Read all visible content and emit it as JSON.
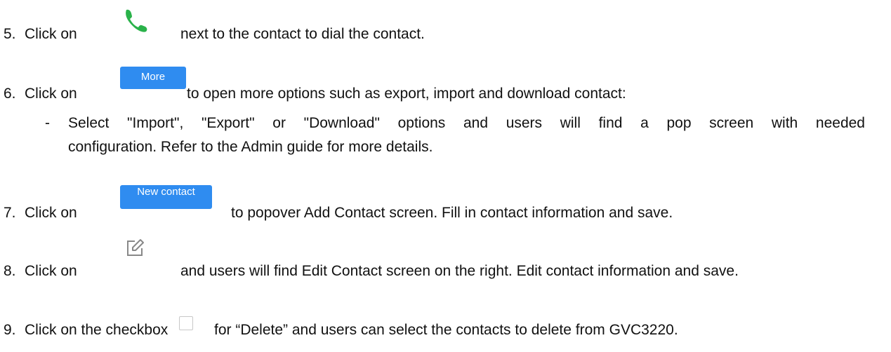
{
  "items": [
    {
      "num": "5.",
      "pre": "Click on",
      "post": "next to the contact to dial the contact."
    },
    {
      "num": "6.",
      "pre": "Click on",
      "button": "More",
      "post": "to open more options such as export, import and download contact:"
    },
    {
      "num": "7.",
      "pre": "Click on",
      "button": "New contact",
      "post": "to popover Add Contact screen. Fill in contact information and save."
    },
    {
      "num": "8.",
      "pre": "Click on",
      "post": "and users will find Edit Contact screen on the right. Edit contact information and save."
    },
    {
      "num": "9.",
      "pre": "Click on the checkbox",
      "post": "for “Delete” and users can select the contacts to delete from GVC3220."
    }
  ],
  "sub_bullet": {
    "marker": "-",
    "line1": "Select \"Import\", \"Export\" or \"Download\" options and users will find a pop screen with needed",
    "line2": "configuration. Refer to the Admin guide for more details."
  },
  "colors": {
    "accent": "#2f8cf0",
    "phone": "#2ab24a",
    "edit_icon": "#888888",
    "checkbox": "#c8c8c8"
  },
  "icons": {
    "item5": "phone-icon",
    "item8": "edit-icon",
    "item9": "checkbox-icon"
  }
}
